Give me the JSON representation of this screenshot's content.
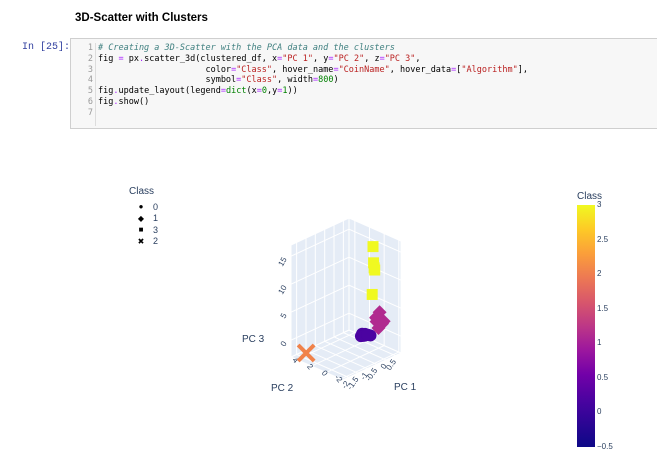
{
  "notebook": {
    "heading": "3D-Scatter with Clusters",
    "prompt": "In [25]:",
    "line_numbers": [
      "1",
      "2",
      "3",
      "4",
      "5",
      "6",
      "7"
    ],
    "code_lines": [
      [
        {
          "t": "# Creating a 3D-Scatter with the PCA data and the clusters",
          "c": "comment"
        }
      ],
      [
        {
          "t": "fig ",
          "c": ""
        },
        {
          "t": "=",
          "c": "op"
        },
        {
          "t": " px",
          "c": ""
        },
        {
          "t": ".",
          "c": "op"
        },
        {
          "t": "scatter_3d(clustered_df, x",
          "c": ""
        },
        {
          "t": "=",
          "c": "op"
        },
        {
          "t": "\"PC 1\"",
          "c": "string"
        },
        {
          "t": ", y",
          "c": ""
        },
        {
          "t": "=",
          "c": "op"
        },
        {
          "t": "\"PC 2\"",
          "c": "string"
        },
        {
          "t": ", z",
          "c": ""
        },
        {
          "t": "=",
          "c": "op"
        },
        {
          "t": "\"PC 3\"",
          "c": "string"
        },
        {
          "t": ",",
          "c": ""
        }
      ],
      [
        {
          "t": "                     color",
          "c": ""
        },
        {
          "t": "=",
          "c": "op"
        },
        {
          "t": "\"Class\"",
          "c": "string"
        },
        {
          "t": ", hover_name",
          "c": ""
        },
        {
          "t": "=",
          "c": "op"
        },
        {
          "t": "\"CoinName\"",
          "c": "string"
        },
        {
          "t": ", hover_data",
          "c": ""
        },
        {
          "t": "=",
          "c": "op"
        },
        {
          "t": "[",
          "c": ""
        },
        {
          "t": "\"Algorithm\"",
          "c": "string"
        },
        {
          "t": "],",
          "c": ""
        }
      ],
      [
        {
          "t": "                     symbol",
          "c": ""
        },
        {
          "t": "=",
          "c": "op"
        },
        {
          "t": "\"Class\"",
          "c": "string"
        },
        {
          "t": ", width",
          "c": ""
        },
        {
          "t": "=",
          "c": "op"
        },
        {
          "t": "800",
          "c": "num"
        },
        {
          "t": ")",
          "c": ""
        }
      ],
      [
        {
          "t": "fig",
          "c": ""
        },
        {
          "t": ".",
          "c": "op"
        },
        {
          "t": "update_layout(legend",
          "c": ""
        },
        {
          "t": "=",
          "c": "op"
        },
        {
          "t": "dict",
          "c": "builtin"
        },
        {
          "t": "(x",
          "c": ""
        },
        {
          "t": "=",
          "c": "op"
        },
        {
          "t": "0",
          "c": "num"
        },
        {
          "t": ",y",
          "c": ""
        },
        {
          "t": "=",
          "c": "op"
        },
        {
          "t": "1",
          "c": "num"
        },
        {
          "t": "))",
          "c": ""
        }
      ],
      [
        {
          "t": "fig",
          "c": ""
        },
        {
          "t": ".",
          "c": "op"
        },
        {
          "t": "show()",
          "c": ""
        }
      ],
      [
        {
          "t": "",
          "c": ""
        }
      ]
    ]
  },
  "chart_data": {
    "type": "scatter",
    "subtype": "scatter_3d",
    "axes": {
      "x": {
        "label": "PC 1",
        "ticks": [
          "-2",
          "-1.5",
          "-1",
          "-0.5",
          "0",
          "0.5"
        ]
      },
      "y": {
        "label": "PC 2",
        "ticks": [
          "-2",
          "0",
          "2",
          "4"
        ]
      },
      "z": {
        "label": "PC 3",
        "ticks": [
          "0",
          "5",
          "10",
          "15"
        ]
      }
    },
    "legend": {
      "title": "Class",
      "placement": "top-left",
      "entries": [
        {
          "label": "0",
          "symbol": "circle-icon",
          "glyph": "●"
        },
        {
          "label": "1",
          "symbol": "diamond-icon",
          "glyph": "◆"
        },
        {
          "label": "3",
          "symbol": "square-icon",
          "glyph": "■"
        },
        {
          "label": "2",
          "symbol": "x-icon",
          "glyph": "✖"
        }
      ]
    },
    "colorbar": {
      "title": "Class",
      "ticks": [
        "3",
        "2.5",
        "2",
        "1.5",
        "1",
        "0.5",
        "0",
        "−0.5"
      ],
      "range": [
        -0.5,
        3
      ],
      "colorscale": [
        "#0d0887",
        "#46039f",
        "#7201a8",
        "#9c179e",
        "#bd3786",
        "#d8576b",
        "#ed7953",
        "#fb9f3a",
        "#fdca26",
        "#f0f921"
      ]
    },
    "series": [
      {
        "name": "0",
        "class": 0,
        "symbol": "circle",
        "color": "#4b03a1",
        "points": [
          {
            "x": -0.4,
            "y": 0.1,
            "z": 0.5
          },
          {
            "x": -0.3,
            "y": 0.2,
            "z": 0.7
          },
          {
            "x": -0.2,
            "y": 0.0,
            "z": 0.4
          },
          {
            "x": -0.1,
            "y": 0.3,
            "z": 0.3
          },
          {
            "x": 0.0,
            "y": 0.1,
            "z": 0.1
          },
          {
            "x": -0.35,
            "y": -0.1,
            "z": 0.6
          },
          {
            "x": -0.15,
            "y": 0.25,
            "z": 0.2
          },
          {
            "x": 0.05,
            "y": -0.05,
            "z": 0.0
          },
          {
            "x": -0.25,
            "y": 0.05,
            "z": 0.35
          },
          {
            "x": -0.05,
            "y": 0.15,
            "z": 0.15
          }
        ]
      },
      {
        "name": "1",
        "class": 1,
        "symbol": "diamond",
        "color": "#b02a8f",
        "points": [
          {
            "x": 0.2,
            "y": -0.5,
            "z": 2.5
          },
          {
            "x": 0.3,
            "y": -0.6,
            "z": 3.2
          },
          {
            "x": 0.4,
            "y": -0.4,
            "z": 3.8
          },
          {
            "x": 0.5,
            "y": -0.7,
            "z": 2.2
          },
          {
            "x": 0.25,
            "y": -0.3,
            "z": 3.0
          },
          {
            "x": 0.45,
            "y": -0.55,
            "z": 1.8
          },
          {
            "x": 0.35,
            "y": -0.45,
            "z": 2.8
          },
          {
            "x": 0.15,
            "y": -0.65,
            "z": 3.5
          },
          {
            "x": 0.55,
            "y": -0.35,
            "z": 1.5
          },
          {
            "x": 0.3,
            "y": -0.5,
            "z": 1.2
          }
        ]
      },
      {
        "name": "3",
        "class": 3,
        "symbol": "square",
        "color": "#f0f921",
        "points": [
          {
            "x": 0.4,
            "y": 0.5,
            "z": 15
          },
          {
            "x": 0.45,
            "y": 0.55,
            "z": 12
          },
          {
            "x": 0.5,
            "y": 0.6,
            "z": 11
          },
          {
            "x": 0.55,
            "y": 0.65,
            "z": 10.5
          },
          {
            "x": 0.2,
            "y": 0.1,
            "z": 7
          }
        ]
      },
      {
        "name": "2",
        "class": 2,
        "symbol": "x",
        "color": "#f0824a",
        "points": [
          {
            "x": -2.0,
            "y": 3.5,
            "z": -2.0
          }
        ]
      }
    ]
  }
}
